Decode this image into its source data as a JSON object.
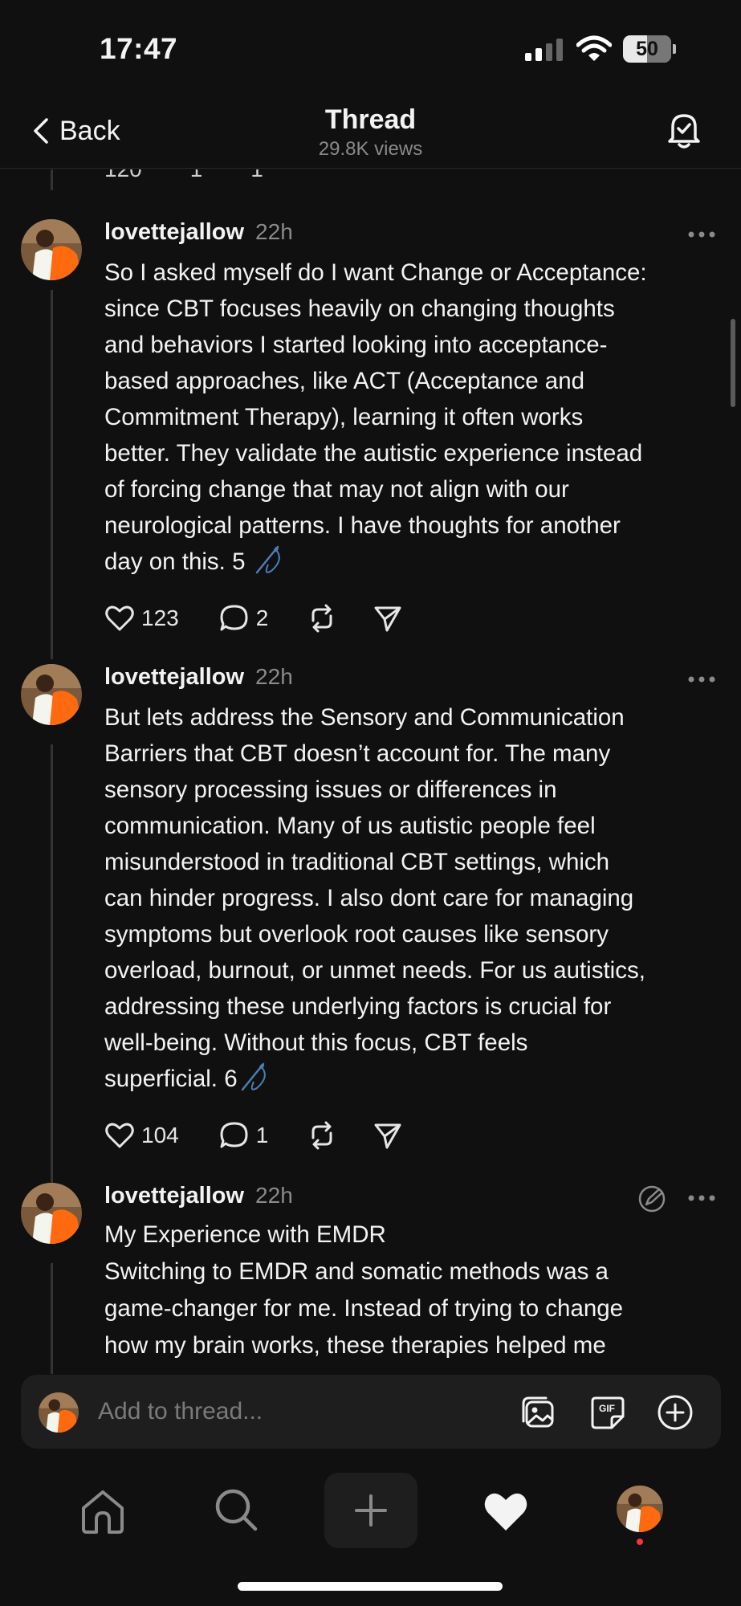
{
  "status_bar": {
    "time": "17:47",
    "battery": "50"
  },
  "header": {
    "back_label": "Back",
    "title": "Thread",
    "views": "29.8K views"
  },
  "partial_post": {
    "likes": "120",
    "replies": "1",
    "reposts": "1"
  },
  "posts": [
    {
      "username": "lovettejallow",
      "time": "22h",
      "text": "So I asked myself do I want Change or Acceptance:\nsince CBT focuses heavily on changing thoughts\nand behaviors I started looking into acceptance-\nbased approaches, like ACT (Acceptance and\nCommitment Therapy), learning it often works\nbetter. They validate the autistic experience instead\nof forcing change that may not align with our\nneurological patterns. I have thoughts for another\nday on this. 5",
      "likes": "123",
      "replies": "2"
    },
    {
      "username": "lovettejallow",
      "time": "22h",
      "text": "But lets address the Sensory and Communication\nBarriers that CBT doesn’t account for. The many\nsensory processing issues or differences in\ncommunication. Many of us autistic people feel\nmisunderstood in traditional CBT settings, which\ncan hinder progress. I also dont care for managing\nsymptoms but overlook root causes like sensory\noverload, burnout, or unmet needs. For us autistics,\naddressing these underlying factors is crucial for\nwell-being. Without this focus, CBT feels\nsuperficial. 6",
      "likes": "104",
      "replies": "1"
    },
    {
      "username": "lovettejallow",
      "time": "22h",
      "text": "My Experience with EMDR\nSwitching to EMDR and somatic methods was a\ngame-changer for me. Instead of trying to change\nhow my brain works, these therapies helped me"
    }
  ],
  "compose": {
    "placeholder": "Add to thread..."
  },
  "colors": {
    "background": "#101010",
    "text": "#f3f3f3",
    "muted": "#8a8a8a",
    "needle": "#4a7fb5",
    "notify": "#ff3040"
  }
}
